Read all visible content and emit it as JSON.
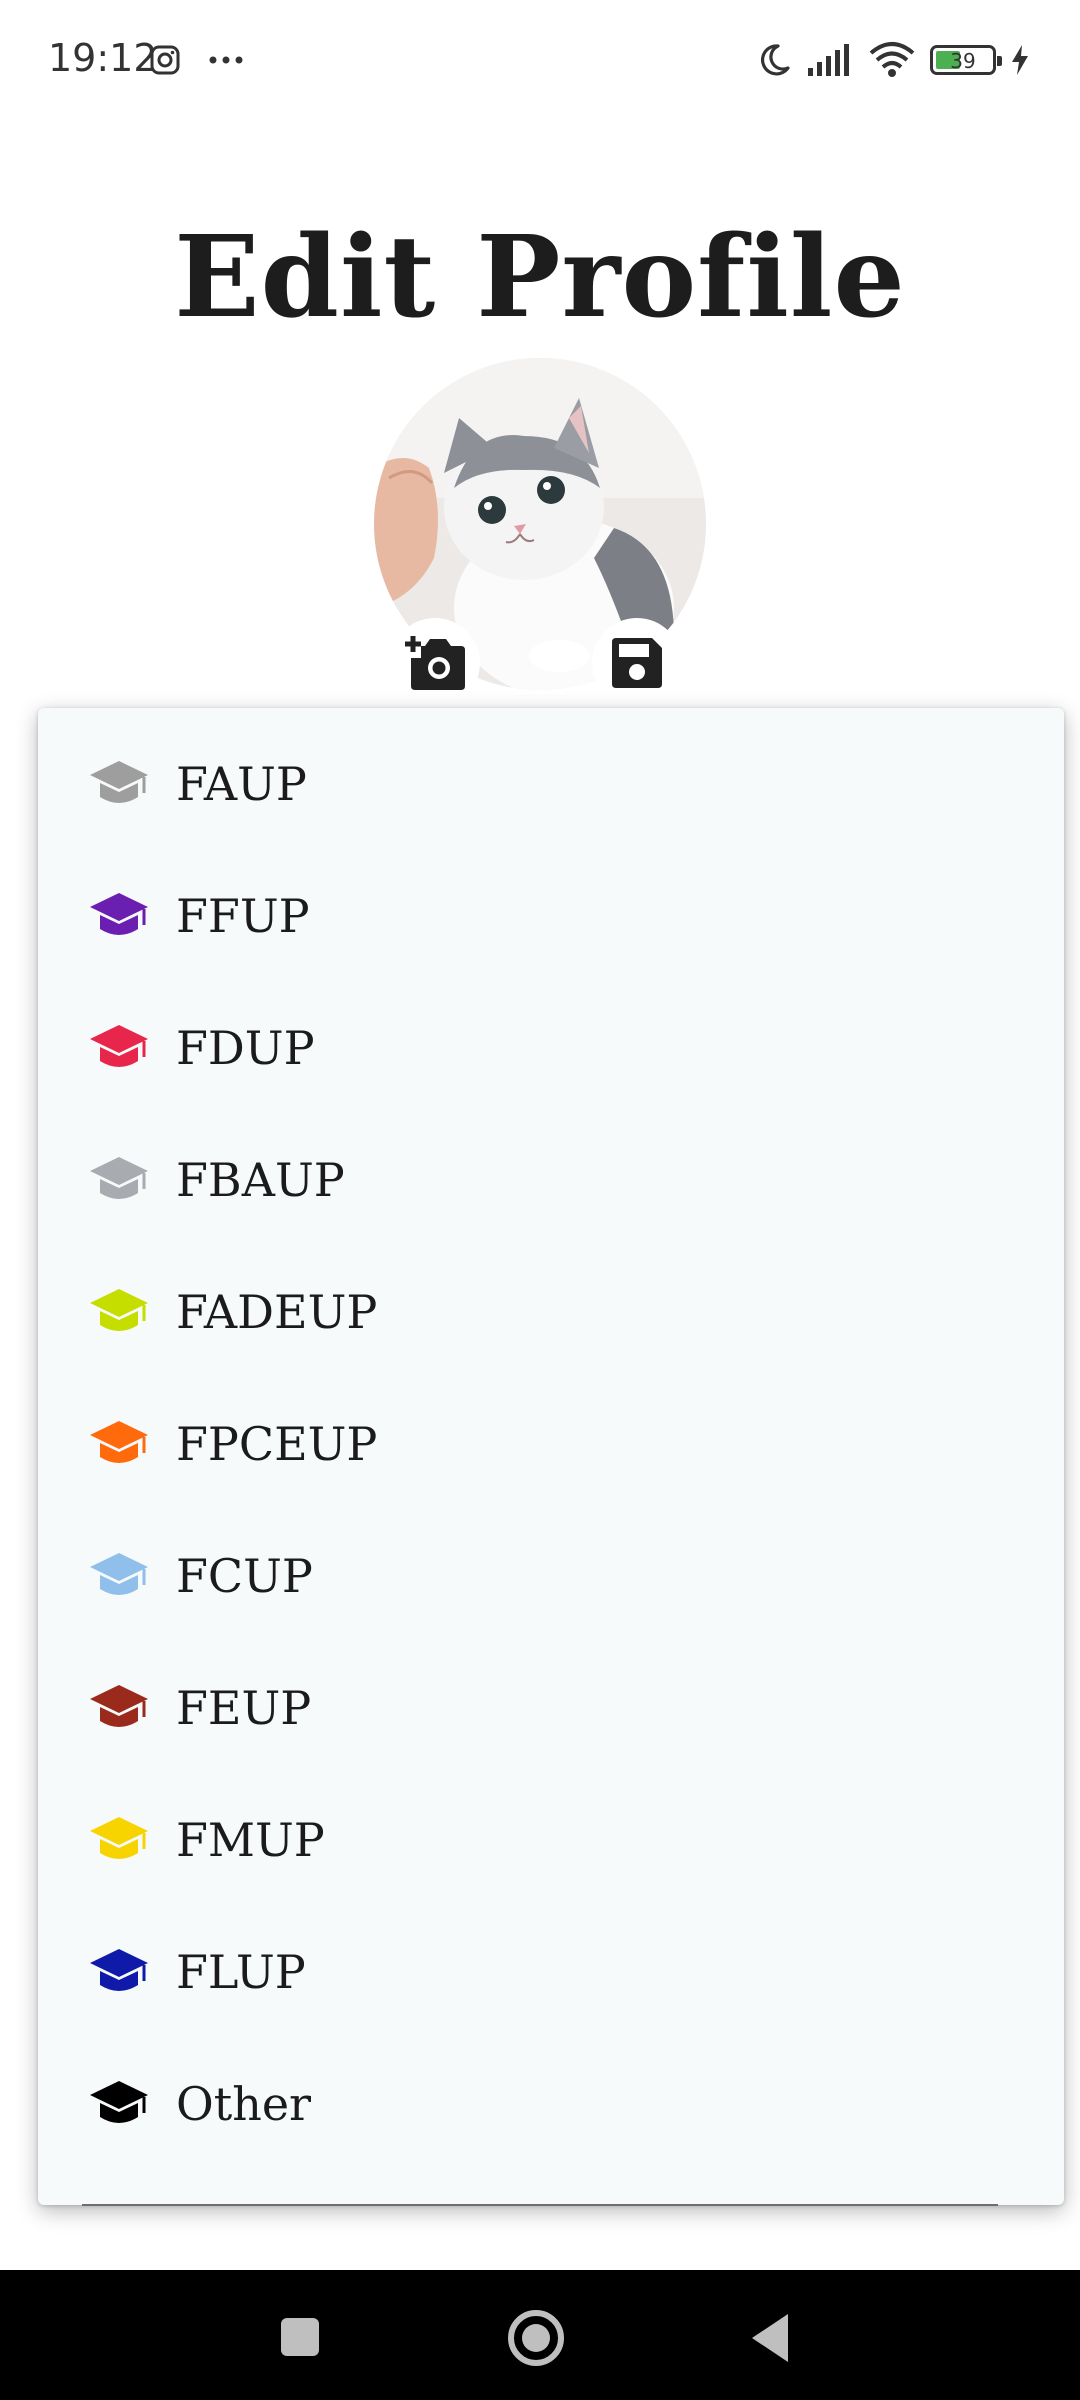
{
  "status_bar": {
    "time": "19:12",
    "battery_level": "39",
    "icons": [
      "instagram-icon",
      "more-dots-icon",
      "moon-icon",
      "signal-icon",
      "wifi-icon",
      "battery-icon",
      "charging-icon"
    ]
  },
  "page": {
    "title": "Edit Profile"
  },
  "avatar": {
    "icons": [
      "add-photo-icon",
      "save-icon"
    ]
  },
  "dropdown": {
    "items": [
      {
        "label": "FAUP",
        "color": "#9e9e9e"
      },
      {
        "label": "FFUP",
        "color": "#6a1fb0"
      },
      {
        "label": "FDUP",
        "color": "#e8254a"
      },
      {
        "label": "FBAUP",
        "color": "#a8abaf"
      },
      {
        "label": "FADEUP",
        "color": "#c6dd00"
      },
      {
        "label": "FPCEUP",
        "color": "#ff6a0d"
      },
      {
        "label": "FCUP",
        "color": "#8fbfea"
      },
      {
        "label": "FEUP",
        "color": "#9a2a1c"
      },
      {
        "label": "FMUP",
        "color": "#f7d400"
      },
      {
        "label": "FLUP",
        "color": "#0f1aa8"
      },
      {
        "label": "Other",
        "color": "#000000"
      }
    ]
  },
  "nav_bar": {
    "icons": [
      "recents-icon",
      "home-icon",
      "back-icon"
    ]
  }
}
